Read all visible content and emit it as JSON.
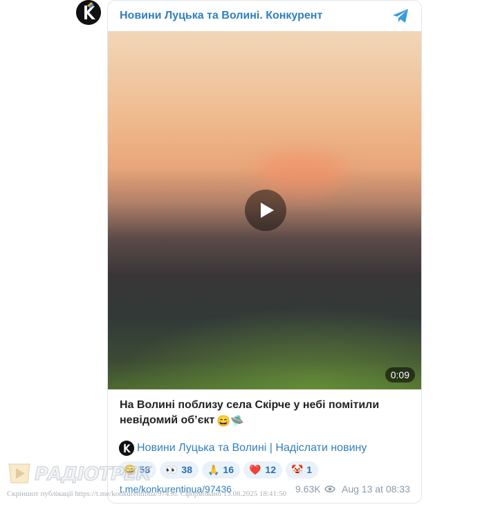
{
  "channel": {
    "name": "Новини Луцька та Волині. Конкурент",
    "avatar_icon": "konkurent-logo-icon",
    "telegram_icon": "telegram-icon"
  },
  "video": {
    "duration": "0:09",
    "play_icon": "play-icon"
  },
  "post": {
    "text": "На Волині поблизу села Скірче у небі помітили невідомий об’єкт",
    "text_emoji": "😄🛸",
    "signature_link": "Новини Луцька та Волині | Надіслати новину"
  },
  "reactions": [
    {
      "emoji": "😄",
      "count": "58"
    },
    {
      "emoji": "👀",
      "count": "38"
    },
    {
      "emoji": "🙏",
      "count": "16"
    },
    {
      "emoji": "❤️",
      "count": "12"
    },
    {
      "emoji": "🤡",
      "count": "1"
    }
  ],
  "footer": {
    "link": "t.me/konkurentinua/97436",
    "views": "9.63K",
    "date": "Aug 13 at 08:33"
  },
  "watermark": {
    "brand": "РАДІОТРЕК",
    "caption": "Скріншот публікації https://t.me/konkurentinua/97436. Сформовано 13.08.2025 18:41:50"
  },
  "colors": {
    "accent": "#2f7fbe",
    "reaction_bg": "#e9f2fa",
    "muted": "#8a9aa8"
  }
}
